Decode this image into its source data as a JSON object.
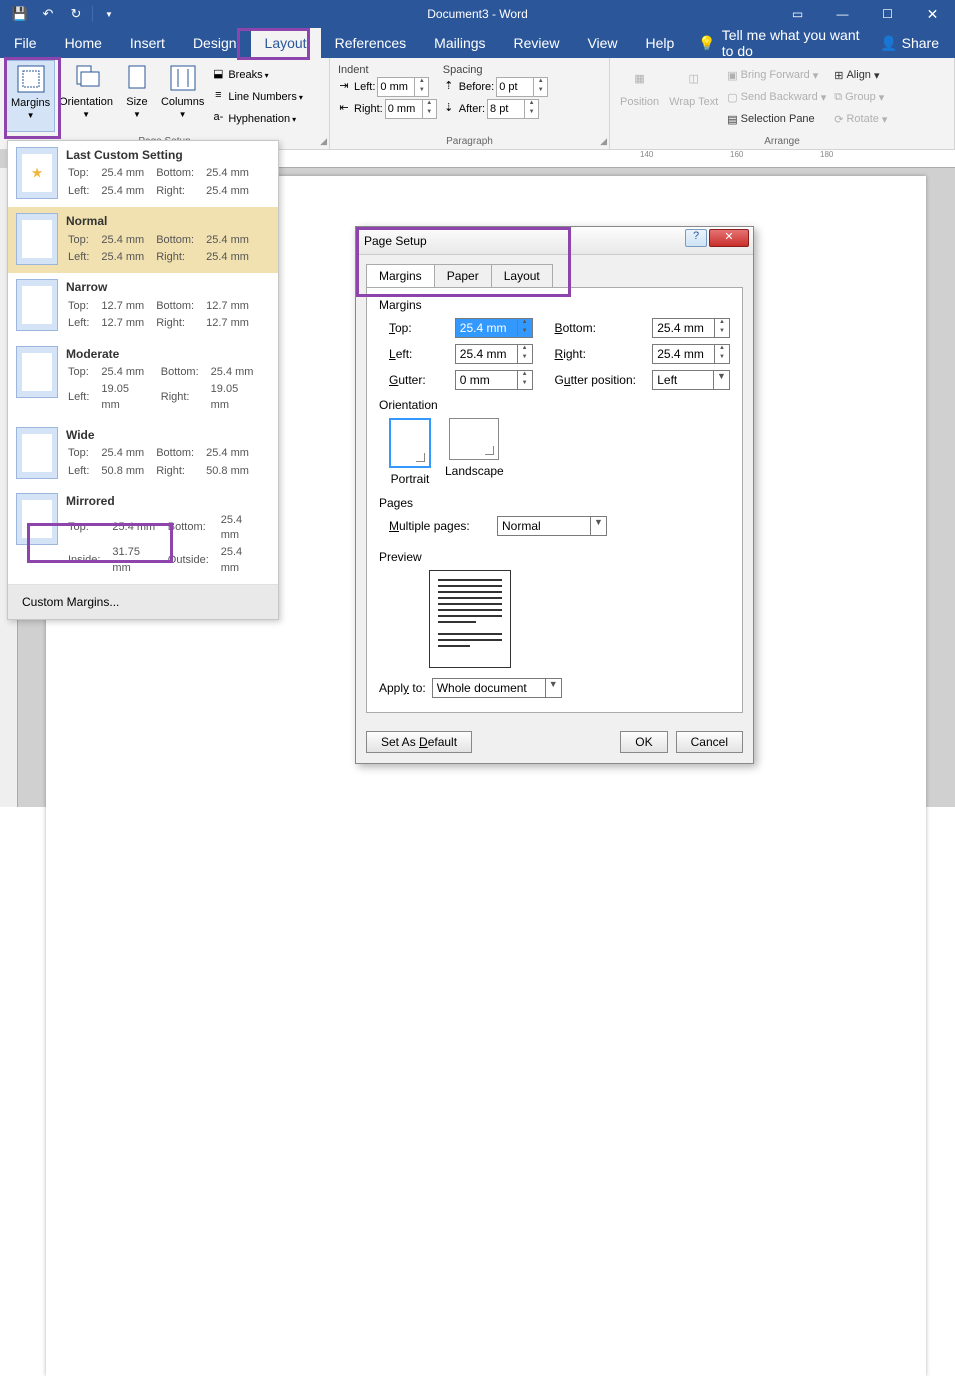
{
  "title": "Document3 - Word",
  "menubar": [
    "File",
    "Home",
    "Insert",
    "Design",
    "Layout",
    "References",
    "Mailings",
    "Review",
    "View",
    "Help"
  ],
  "active_tab": "Layout",
  "tellme": "Tell me what you want to do",
  "share": "Share",
  "ribbon": {
    "page_setup": {
      "margins": "Margins",
      "orientation": "Orientation",
      "size": "Size",
      "columns": "Columns",
      "breaks": "Breaks",
      "line_numbers": "Line Numbers",
      "hyphenation": "Hyphenation",
      "group": "Page Setup"
    },
    "paragraph": {
      "indent": "Indent",
      "left": "Left:",
      "right": "Right:",
      "left_val": "0 mm",
      "right_val": "0 mm",
      "spacing": "Spacing",
      "before": "Before:",
      "after": "After:",
      "before_val": "0 pt",
      "after_val": "8 pt",
      "group": "Paragraph"
    },
    "arrange": {
      "position": "Position",
      "wrap": "Wrap Text",
      "bring_forward": "Bring Forward",
      "send_backward": "Send Backward",
      "selection_pane": "Selection Pane",
      "align": "Align",
      "group_btn": "Group",
      "rotate": "Rotate",
      "group": "Arrange"
    }
  },
  "margins_menu": {
    "items": [
      {
        "name": "Last Custom Setting",
        "t": "25.4 mm",
        "b": "25.4 mm",
        "l": "25.4 mm",
        "r": "25.4 mm",
        "star": true
      },
      {
        "name": "Normal",
        "t": "25.4 mm",
        "b": "25.4 mm",
        "l": "25.4 mm",
        "r": "25.4 mm"
      },
      {
        "name": "Narrow",
        "t": "12.7 mm",
        "b": "12.7 mm",
        "l": "12.7 mm",
        "r": "12.7 mm"
      },
      {
        "name": "Moderate",
        "t": "25.4 mm",
        "b": "25.4 mm",
        "l": "19.05 mm",
        "r": "19.05 mm"
      },
      {
        "name": "Wide",
        "t": "25.4 mm",
        "b": "25.4 mm",
        "l": "50.8 mm",
        "r": "50.8 mm"
      },
      {
        "name": "Mirrored",
        "t": "25.4 mm",
        "b": "25.4 mm",
        "l": "31.75 mm",
        "r": "25.4 mm",
        "inside": true
      }
    ],
    "top_lbl": "Top:",
    "bottom_lbl": "Bottom:",
    "left_lbl": "Left:",
    "right_lbl": "Right:",
    "inside_lbl": "Inside:",
    "outside_lbl": "Outside:",
    "custom": "Custom Margins..."
  },
  "dialog": {
    "title": "Page Setup",
    "tabs": [
      "Margins",
      "Paper",
      "Layout"
    ],
    "active_tab": "Margins",
    "margins_section": "Margins",
    "top": "Top:",
    "top_val": "25.4 mm",
    "bottom": "Bottom:",
    "bottom_val": "25.4 mm",
    "left": "Left:",
    "left_val": "25.4 mm",
    "right": "Right:",
    "right_val": "25.4 mm",
    "gutter": "Gutter:",
    "gutter_val": "0 mm",
    "gutter_pos": "Gutter position:",
    "gutter_pos_val": "Left",
    "orientation": "Orientation",
    "portrait": "Portrait",
    "landscape": "Landscape",
    "pages": "Pages",
    "multiple": "Multiple pages:",
    "multiple_val": "Normal",
    "preview": "Preview",
    "apply_to": "Apply to:",
    "apply_to_val": "Whole document",
    "set_default": "Set As Default",
    "ok": "OK",
    "cancel": "Cancel"
  },
  "ruler_marks": [
    "140",
    "160",
    "180"
  ]
}
